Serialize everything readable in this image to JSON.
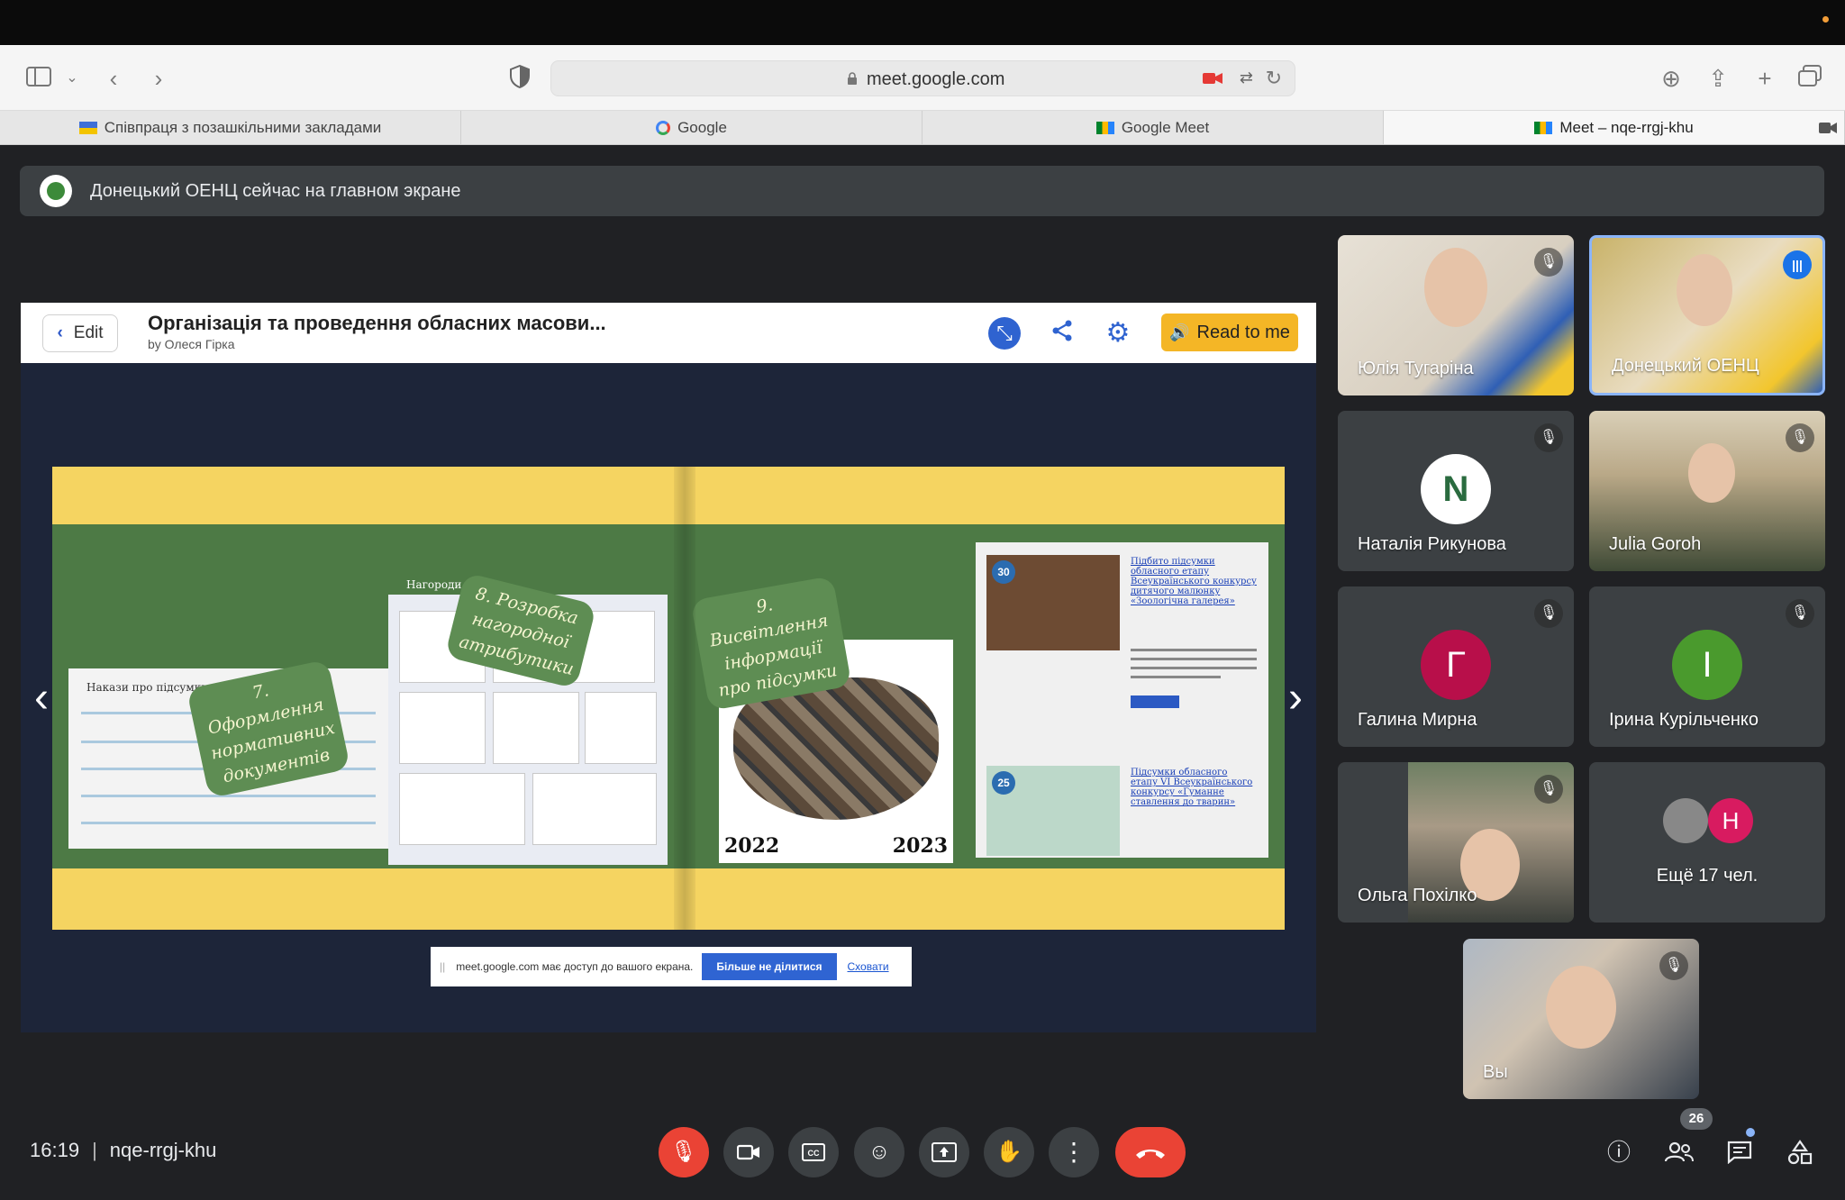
{
  "browser": {
    "url": "meet.google.com",
    "tabs": [
      {
        "label": "Співпраця з позашкільними закладами"
      },
      {
        "label": "Google"
      },
      {
        "label": "Google Meet"
      },
      {
        "label": "Meet – nqe-rrgj-khu"
      }
    ]
  },
  "banner": {
    "text": "Донецький ОЕНЦ сейчас на главном экране"
  },
  "presentation": {
    "edit_label": "Edit",
    "title": "Організація та проведення обласних масови...",
    "author": "by Олеся Гірка",
    "read_label": "Read to me",
    "stickers": [
      "7. Оформлення нормативних документів",
      "8. Розробка нагородної атрибутики",
      "9. Висвітлення інформації про підсумки"
    ],
    "page1_caption": "Накази про підсумки",
    "page2_caption": "Нагороди",
    "page3_year_left": "2022",
    "page3_year_right": "2023",
    "badge_a": "30",
    "badge_b": "25",
    "page4_link_a": "Підбито підсумки обласного етапу Всеукраїнського конкурсу дитячого малюнку «Зоологічна галерея»",
    "page4_link_b": "Підсумки обласного етапу VI Всеукраїнського конкурсу «Гуманне ставлення до тварин»"
  },
  "share_notice": {
    "text": "meet.google.com має доступ до вашого екрана.",
    "stop_label": "Більше не ділитися",
    "hide_label": "Сховати"
  },
  "participants": [
    {
      "name": "Юлія Тугаріна"
    },
    {
      "name": "Донецький ОЕНЦ"
    },
    {
      "name": "Наталія Рикунова",
      "initial": "N",
      "color": "#ffffff"
    },
    {
      "name": "Julia Goroh"
    },
    {
      "name": "Галина Мирна",
      "initial": "Г",
      "color": "#b80f4a"
    },
    {
      "name": "Ірина Курільченко",
      "initial": "І",
      "color": "#4a9a2d"
    },
    {
      "name": "Ольга Похілко"
    },
    {
      "name": "Ещё 17 чел.",
      "initial": "Н",
      "color": "#d81b60"
    },
    {
      "name": "Вы"
    }
  ],
  "meeting": {
    "time": "16:19",
    "code": "nqe-rrgj-khu",
    "people_count": "26"
  }
}
